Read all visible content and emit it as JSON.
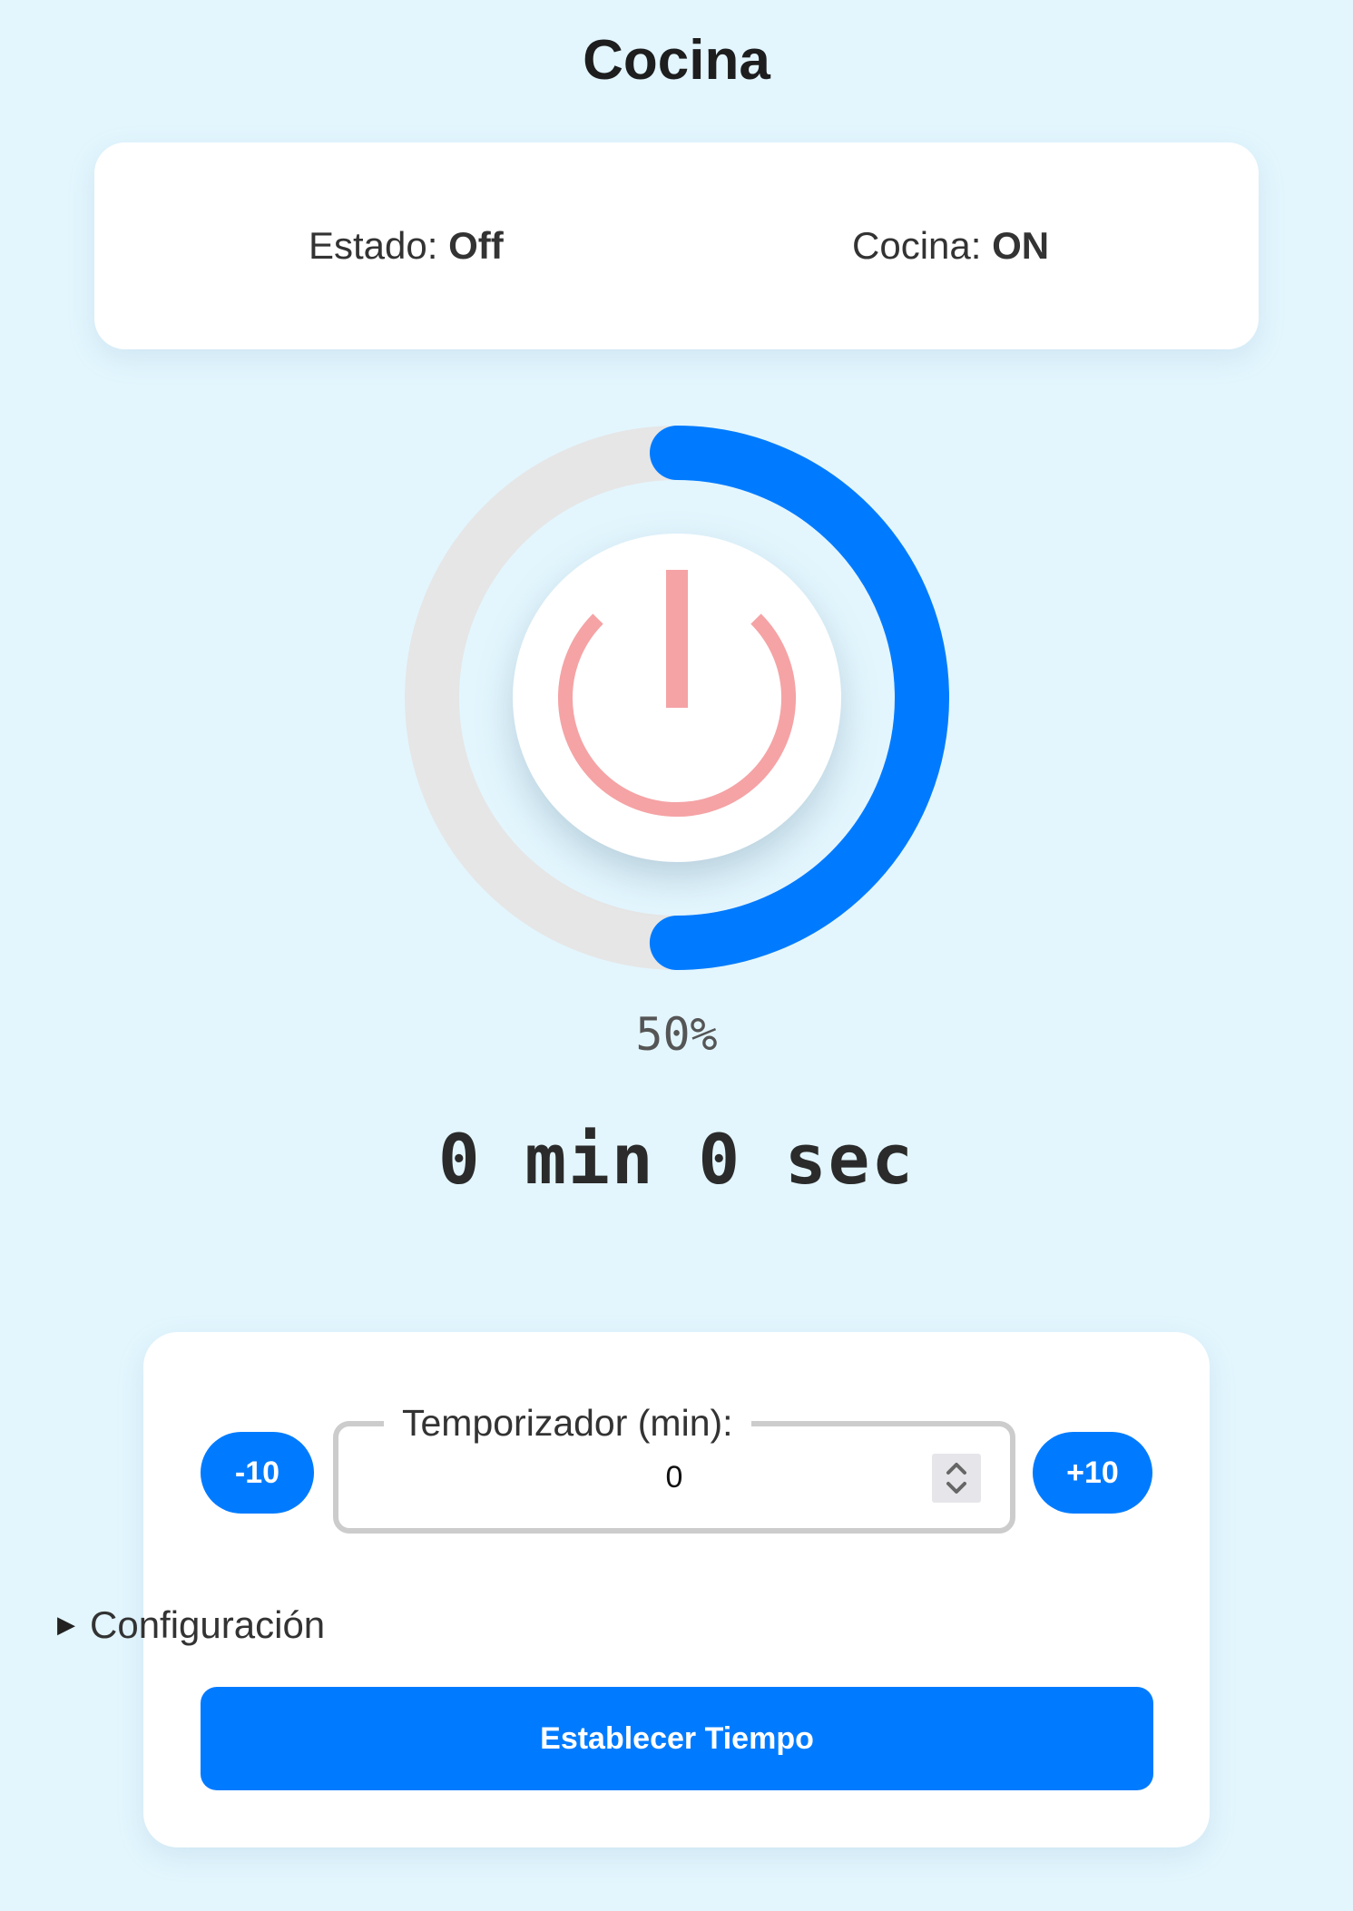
{
  "title": "Cocina",
  "status": {
    "estado_label": "Estado:",
    "estado_value": "Off",
    "cocina_label": "Cocina:",
    "cocina_value": "ON"
  },
  "dial": {
    "percent_text": "50%",
    "progress_fraction": 0.5,
    "track_color": "#e6e6e6",
    "progress_color": "#007bff",
    "power_icon": "power-icon",
    "power_icon_color": "#f5a3a5"
  },
  "timer": {
    "display": "0 min 0 sec"
  },
  "controls": {
    "minus_label": "-10",
    "plus_label": "+10",
    "field_legend": "Temporizador (min):",
    "field_value": "0",
    "config_label": "Configuración",
    "submit_label": "Establecer Tiempo"
  }
}
